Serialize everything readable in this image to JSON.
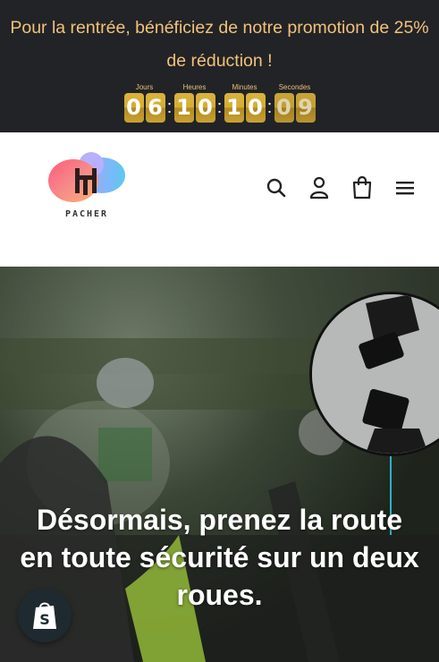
{
  "promo": {
    "text": "Pour la rentrée, bénéficiez de notre promotion de 25% de réduction !",
    "colors": {
      "background": "#222326",
      "text": "#f1c27a",
      "digit": "#d6ad33"
    }
  },
  "countdown": {
    "days_label": "Jours",
    "hours_label": "Heures",
    "minutes_label": "Minutes",
    "seconds_label": "Secondes",
    "days": [
      "0",
      "6"
    ],
    "hours": [
      "1",
      "0"
    ],
    "minutes": [
      "1",
      "0"
    ],
    "seconds": [
      "0",
      "9"
    ],
    "separator": ":"
  },
  "header": {
    "logo_text": "PACHER",
    "icons": [
      "search-icon",
      "account-icon",
      "cart-icon",
      "menu-icon"
    ]
  },
  "hero": {
    "title": "Désormais, prenez la route en toute sécurité sur un deux roues."
  },
  "badge": {
    "icon": "shopify-icon"
  }
}
